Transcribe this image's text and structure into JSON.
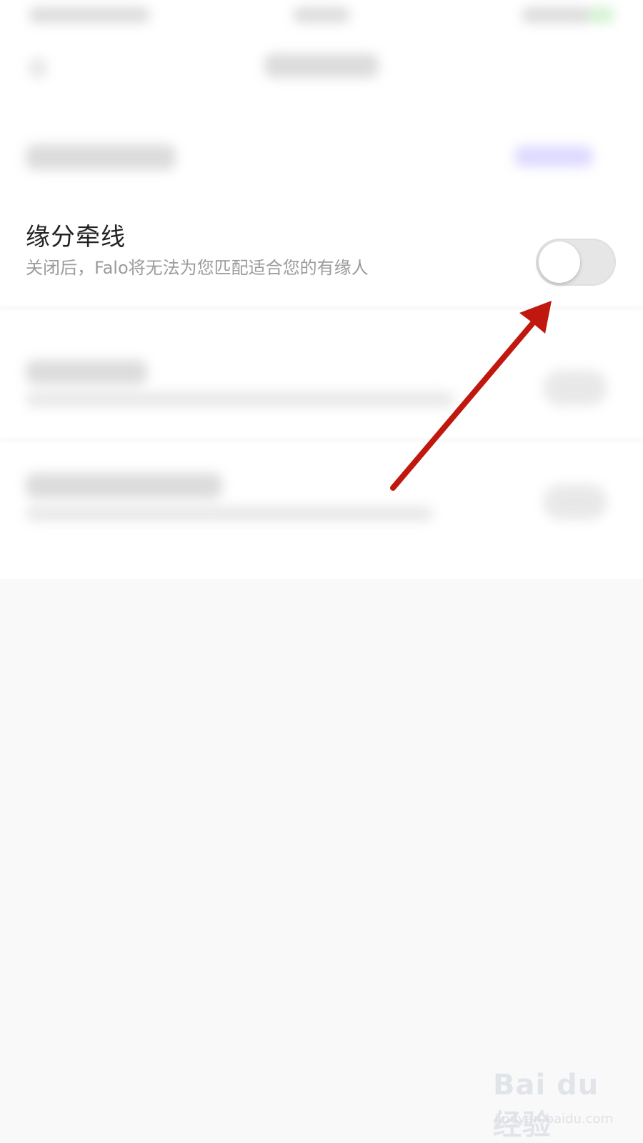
{
  "setting": {
    "title": "缘分牵线",
    "description": "关闭后，Falo将无法为您匹配适合您的有缘人",
    "toggle_on": false
  },
  "watermark": {
    "logo": "Bai du 经验",
    "url": "jingyan.baidu.com"
  }
}
